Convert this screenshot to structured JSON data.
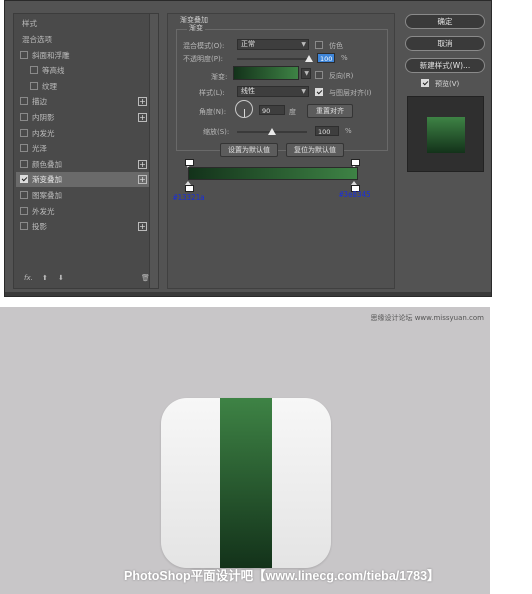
{
  "dialog": {
    "left_panel": {
      "header": "样式",
      "items": [
        {
          "label": "混合选项",
          "checkbox": false,
          "checked": false,
          "plus": false,
          "indent": false,
          "active": false
        },
        {
          "label": "斜面和浮雕",
          "checkbox": true,
          "checked": false,
          "plus": false,
          "indent": false,
          "active": false
        },
        {
          "label": "等高线",
          "checkbox": true,
          "checked": false,
          "plus": false,
          "indent": true,
          "active": false
        },
        {
          "label": "纹理",
          "checkbox": true,
          "checked": false,
          "plus": false,
          "indent": true,
          "active": false
        },
        {
          "label": "描边",
          "checkbox": true,
          "checked": false,
          "plus": true,
          "indent": false,
          "active": false
        },
        {
          "label": "内阴影",
          "checkbox": true,
          "checked": false,
          "plus": true,
          "indent": false,
          "active": false
        },
        {
          "label": "内发光",
          "checkbox": true,
          "checked": false,
          "plus": false,
          "indent": false,
          "active": false
        },
        {
          "label": "光泽",
          "checkbox": true,
          "checked": false,
          "plus": false,
          "indent": false,
          "active": false
        },
        {
          "label": "颜色叠加",
          "checkbox": true,
          "checked": false,
          "plus": true,
          "indent": false,
          "active": false
        },
        {
          "label": "渐变叠加",
          "checkbox": true,
          "checked": true,
          "plus": true,
          "indent": false,
          "active": true
        },
        {
          "label": "图案叠加",
          "checkbox": true,
          "checked": false,
          "plus": false,
          "indent": false,
          "active": false
        },
        {
          "label": "外发光",
          "checkbox": true,
          "checked": false,
          "plus": false,
          "indent": false,
          "active": false
        },
        {
          "label": "投影",
          "checkbox": true,
          "checked": false,
          "plus": true,
          "indent": false,
          "active": false
        }
      ],
      "footer": {
        "fx": "fx.",
        "up": "⬆",
        "down": "⬇",
        "trash": "🗑"
      }
    },
    "gradient_overlay": {
      "title": "渐变叠加",
      "group_title": "渐变",
      "blend_mode_label": "混合模式(O):",
      "blend_mode_value": "正常",
      "dither_label": "仿色",
      "opacity_label": "不透明度(P):",
      "opacity_value": "100",
      "opacity_unit": "%",
      "gradient_label": "渐变:",
      "reverse_label": "反向(R)",
      "style_label": "样式(L):",
      "style_value": "线性",
      "align_layer_label": "与图层对齐(I)",
      "angle_label": "角度(N):",
      "angle_value": "90",
      "angle_unit": "度",
      "reset_align_button": "重置对齐",
      "scale_label": "缩放(S):",
      "scale_value": "100",
      "scale_unit": "%",
      "set_default_button": "设置为默认值",
      "reset_default_button": "复位为默认值",
      "opacity_fraction": 1.0,
      "scale_fraction": 0.5
    },
    "gradient_editor": {
      "stop_left_color": "#13321a",
      "stop_right_color": "#3e8345",
      "stop_left_label": "#13321a",
      "stop_right_label": "#3e8345"
    },
    "right_panel": {
      "ok_button": "确定",
      "cancel_button": "取消",
      "new_style_button": "新建样式(W)...",
      "preview_label": "预览(V)",
      "preview_checked": true
    }
  },
  "canvas": {
    "background_color": "#c8c6c8",
    "watermark_top": "思缘设计论坛 www.missyuan.com",
    "watermark_bottom": "PhotoShop平面设计吧【www.linecg.com/tieba/1783】"
  }
}
